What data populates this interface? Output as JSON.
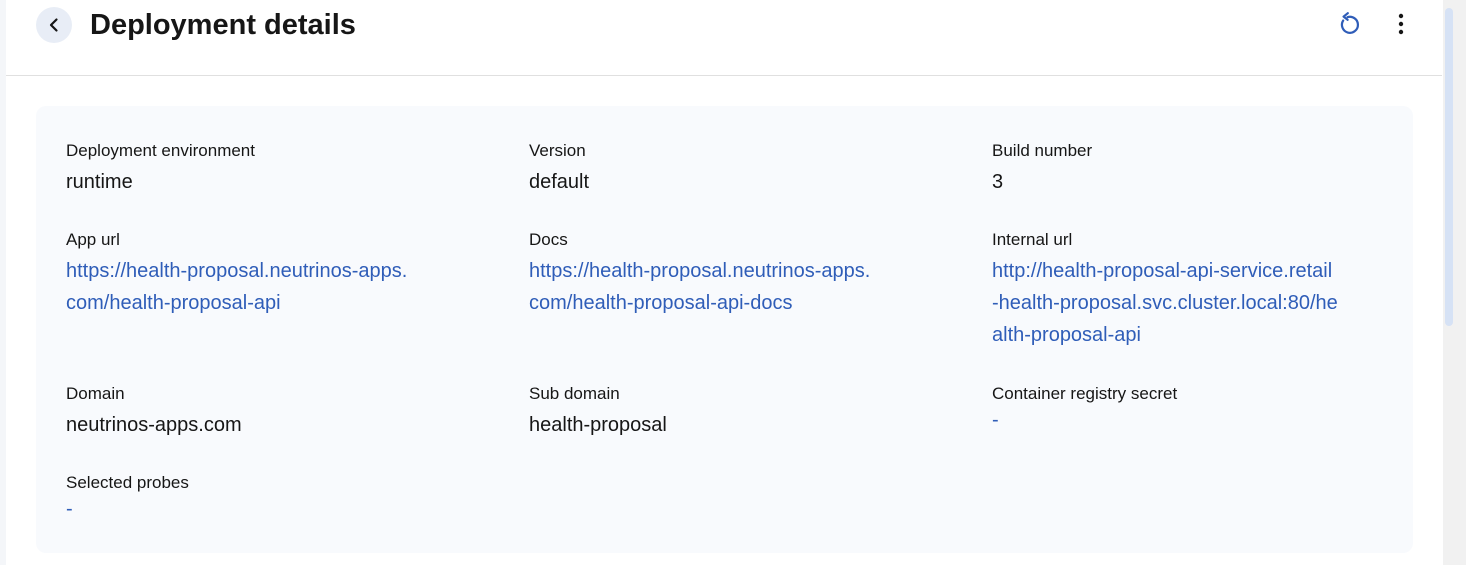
{
  "header": {
    "title": "Deployment details",
    "back_icon": "chevron-left-icon",
    "refresh_icon": "refresh-icon",
    "more_icon": "kebab-menu-icon"
  },
  "details": {
    "deployment_environment": {
      "label": "Deployment environment",
      "value": "runtime"
    },
    "version": {
      "label": "Version",
      "value": "default"
    },
    "build_number": {
      "label": "Build number",
      "value": "3"
    },
    "app_url": {
      "label": "App url",
      "value": "https://health-proposal.neutrinos-apps.\ncom/health-proposal-api"
    },
    "docs": {
      "label": "Docs",
      "value": "https://health-proposal.neutrinos-apps.\ncom/health-proposal-api-docs"
    },
    "internal_url": {
      "label": "Internal url",
      "value": "http://health-proposal-api-service.retail\n-health-proposal.svc.cluster.local:80/he\nalth-proposal-api"
    },
    "domain": {
      "label": "Domain",
      "value": "neutrinos-apps.com"
    },
    "sub_domain": {
      "label": "Sub domain",
      "value": "health-proposal"
    },
    "container_registry_secret": {
      "label": "Container registry secret",
      "value": "-"
    },
    "selected_probes": {
      "label": "Selected probes",
      "value": "-"
    }
  },
  "colors": {
    "link": "#2f5db8",
    "card_background": "#f8fafd",
    "back_button_background": "#e8edf6"
  }
}
